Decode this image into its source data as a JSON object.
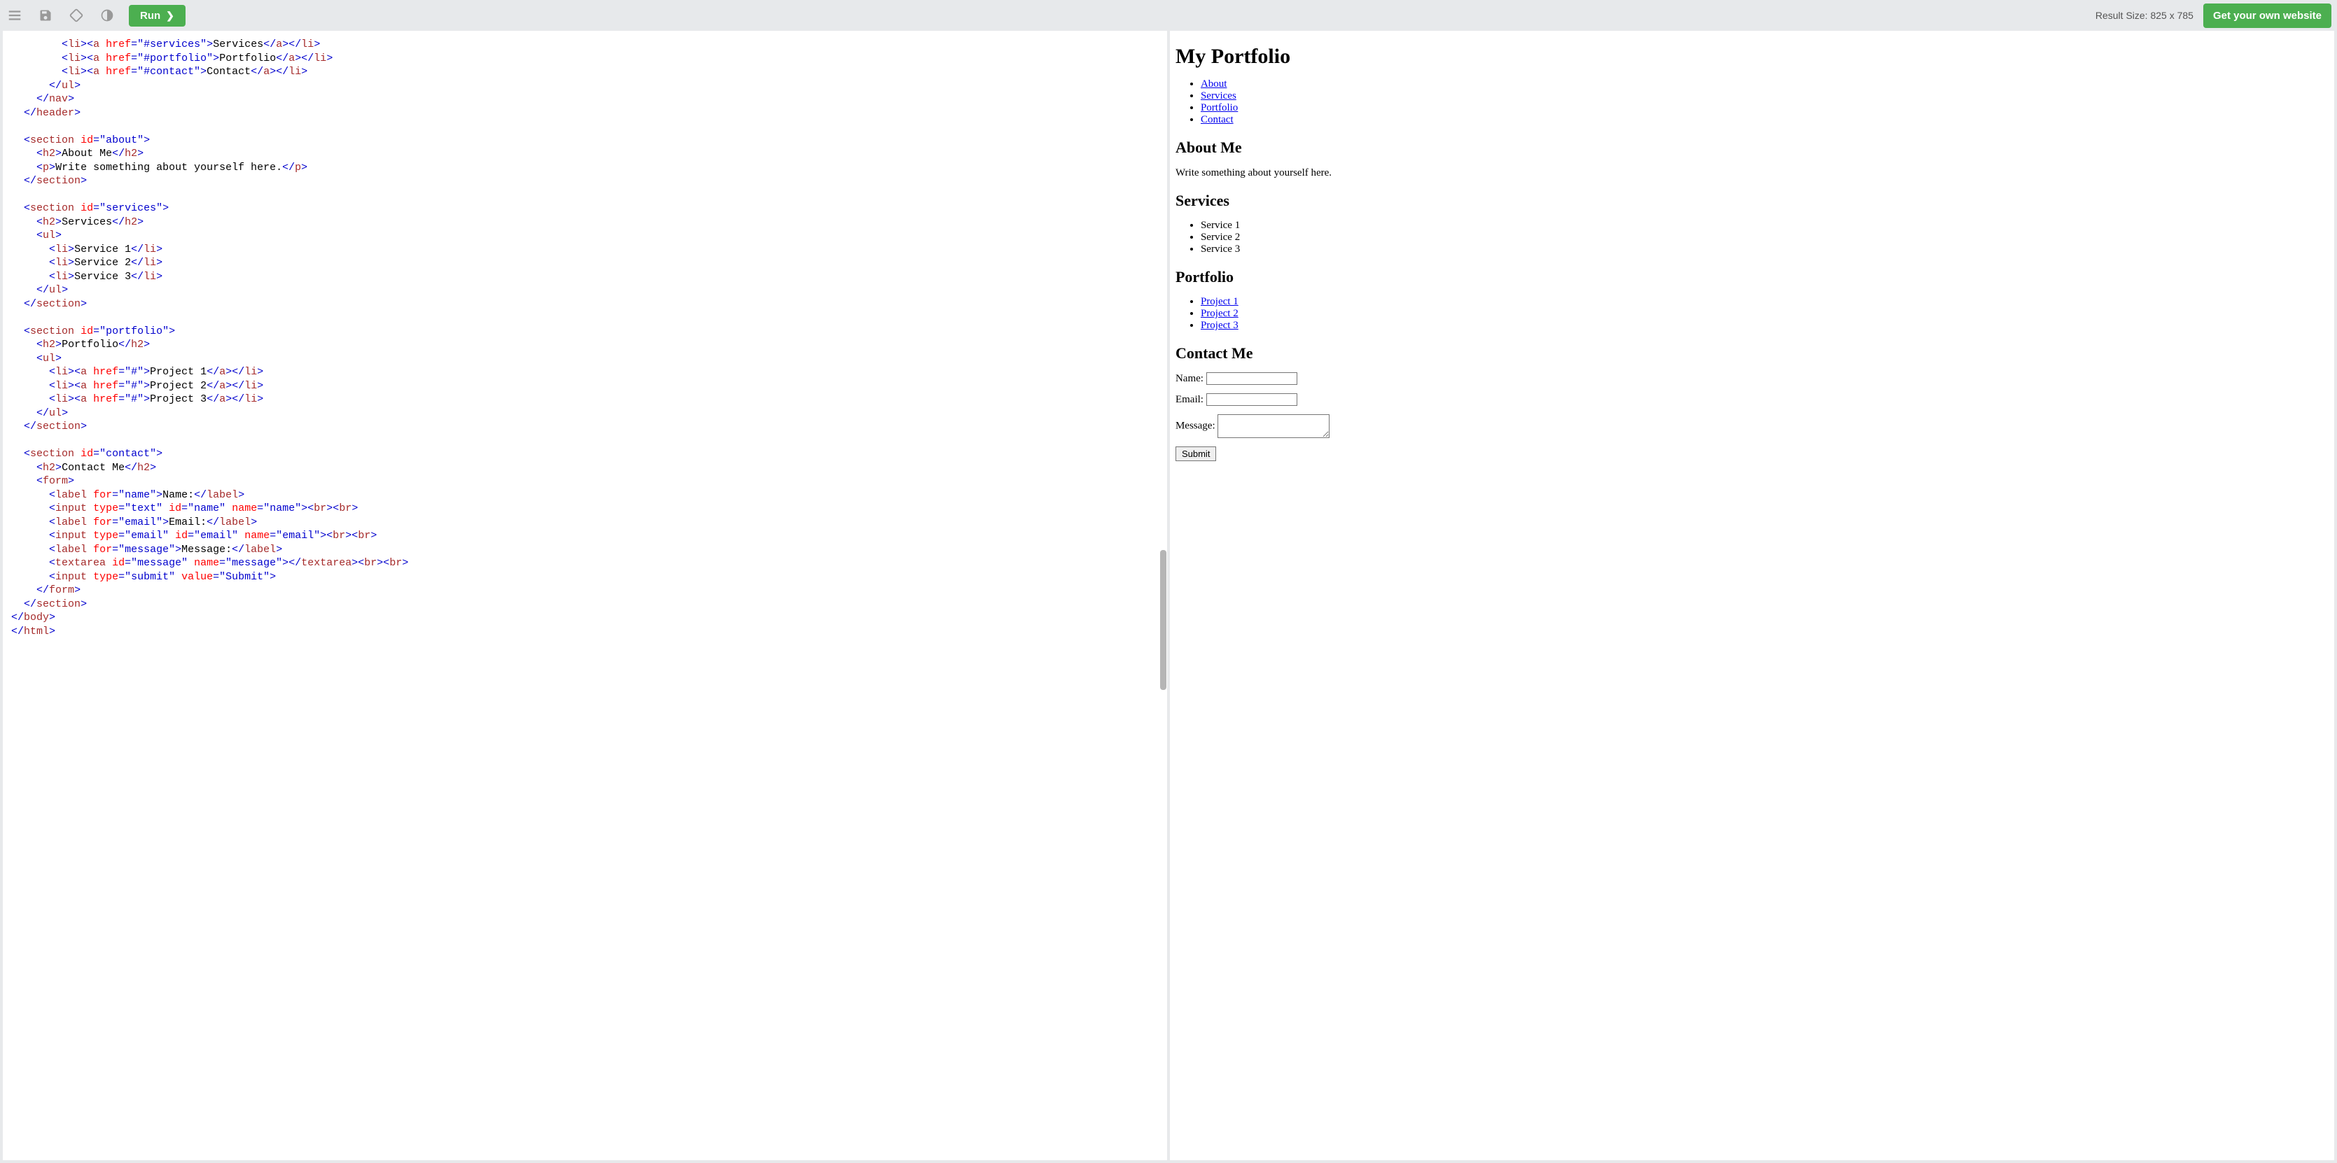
{
  "toolbar": {
    "run_label": "Run",
    "result_size": "Result Size: 825 x 785",
    "get_site_label": "Get your own website"
  },
  "editor": {
    "raw_code": "        <li><a href=\"#services\">Services</a></li>\n        <li><a href=\"#portfolio\">Portfolio</a></li>\n        <li><a href=\"#contact\">Contact</a></li>\n      </ul>\n    </nav>\n  </header>\n\n  <section id=\"about\">\n    <h2>About Me</h2>\n    <p>Write something about yourself here.</p>\n  </section>\n\n  <section id=\"services\">\n    <h2>Services</h2>\n    <ul>\n      <li>Service 1</li>\n      <li>Service 2</li>\n      <li>Service 3</li>\n    </ul>\n  </section>\n\n  <section id=\"portfolio\">\n    <h2>Portfolio</h2>\n    <ul>\n      <li><a href=\"#\">Project 1</a></li>\n      <li><a href=\"#\">Project 2</a></li>\n      <li><a href=\"#\">Project 3</a></li>\n    </ul>\n  </section>\n\n  <section id=\"contact\">\n    <h2>Contact Me</h2>\n    <form>\n      <label for=\"name\">Name:</label>\n      <input type=\"text\" id=\"name\" name=\"name\"><br><br>\n      <label for=\"email\">Email:</label>\n      <input type=\"email\" id=\"email\" name=\"email\"><br><br>\n      <label for=\"message\">Message:</label>\n      <textarea id=\"message\" name=\"message\"></textarea><br><br>\n      <input type=\"submit\" value=\"Submit\">\n    </form>\n  </section>\n</body>\n</html>"
  },
  "result": {
    "title": "My Portfolio",
    "nav": [
      "About",
      "Services",
      "Portfolio",
      "Contact"
    ],
    "about": {
      "heading": "About Me",
      "text": "Write something about yourself here."
    },
    "services": {
      "heading": "Services",
      "items": [
        "Service 1",
        "Service 2",
        "Service 3"
      ]
    },
    "portfolio": {
      "heading": "Portfolio",
      "items": [
        "Project 1",
        "Project 2",
        "Project 3"
      ]
    },
    "contact": {
      "heading": "Contact Me",
      "name_label": "Name:",
      "email_label": "Email:",
      "message_label": "Message:",
      "submit_value": "Submit"
    }
  }
}
